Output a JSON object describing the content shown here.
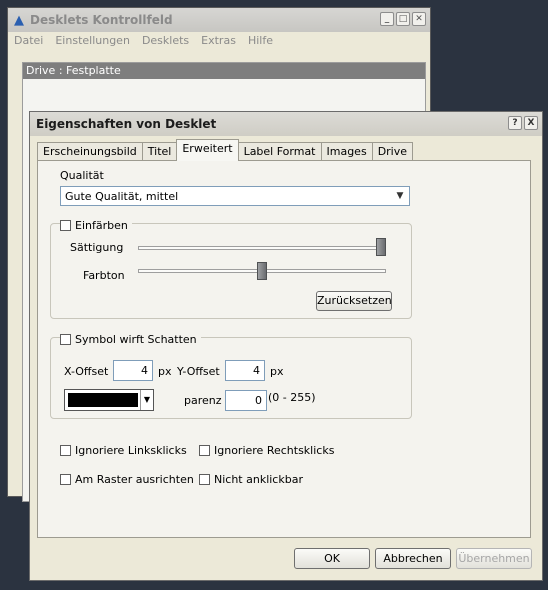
{
  "back_window": {
    "title": "Desklets Kontrollfeld",
    "menu": [
      "Datei",
      "Einstellungen",
      "Desklets",
      "Extras",
      "Hilfe"
    ],
    "list_items": [
      "Drive : Festplatte"
    ]
  },
  "dialog": {
    "title": "Eigenschaften von Desklet",
    "help_button": "?",
    "close_button": "X",
    "tabs": [
      "Erscheinungsbild",
      "Titel",
      "Erweitert",
      "Label Format",
      "Images",
      "Drive"
    ],
    "active_tab": "Erweitert",
    "quality_label": "Qualität",
    "quality_value": "Gute Qualität, mittel",
    "colorize": {
      "checkbox_label": "Einfärben",
      "saturation_label": "Sättigung",
      "saturation_level": 1.0,
      "hue_label": "Farbton",
      "hue_level": 0.5,
      "reset_button": "Zurücksetzen"
    },
    "shadow": {
      "checkbox_label": "Symbol wirft Schatten",
      "x_offset_label": "X-Offset",
      "x_offset_value": "4",
      "x_unit": "px",
      "y_offset_label": "Y-Offset",
      "y_offset_value": "4",
      "y_unit": "px",
      "color": "#000000",
      "transparency_label": "parenz",
      "transparency_value": "0",
      "transparency_range": "(0 - 255)"
    },
    "options": {
      "ignore_left": "Ignoriere Linksklicks",
      "ignore_right": "Ignoriere Rechtsklicks",
      "snap_grid": "Am Raster ausrichten",
      "not_clickable": "Nicht anklickbar"
    },
    "buttons": {
      "ok": "OK",
      "cancel": "Abbrechen",
      "apply": "Übernehmen"
    }
  }
}
